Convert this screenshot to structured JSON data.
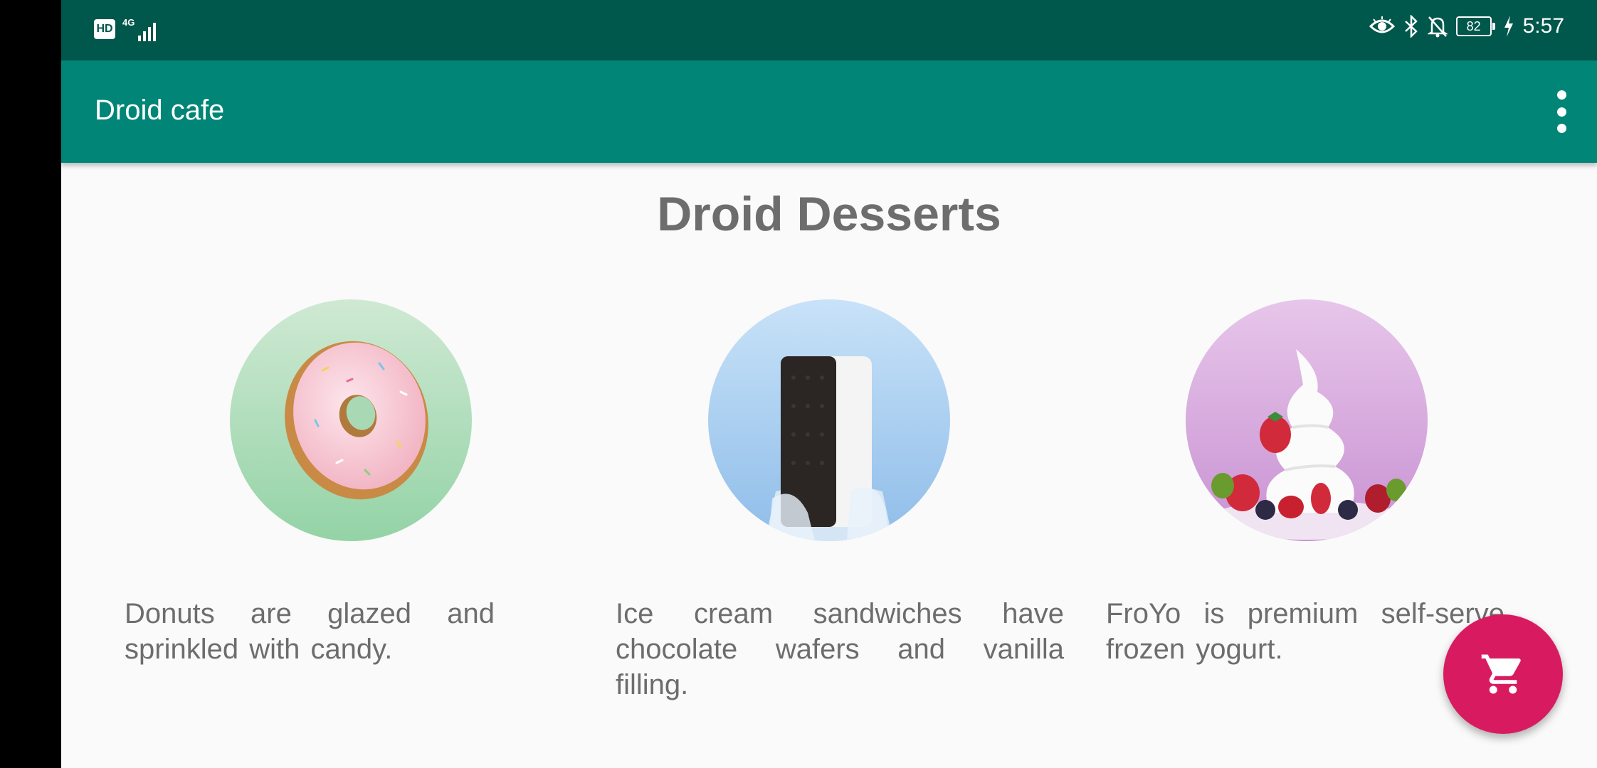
{
  "status_bar": {
    "hd_badge": "HD",
    "network": "4G",
    "battery": "82",
    "time": "5:57",
    "icons": [
      "eye-icon",
      "bluetooth-icon",
      "notifications-off-icon",
      "battery-icon",
      "charging-icon"
    ]
  },
  "app_bar": {
    "title": "Droid cafe",
    "overflow_icon": "more-vert-icon",
    "color": "#008577",
    "status_color": "#00574b"
  },
  "main": {
    "heading": "Droid Desserts",
    "items": [
      {
        "image": "donut",
        "description": "Donuts are glazed and sprinkled with candy."
      },
      {
        "image": "ice-cream-sandwich",
        "description": "Ice cream sandwiches have chocolate wafers and vanilla filling."
      },
      {
        "image": "froyo",
        "description": "FroYo is premium self-serve frozen yogurt."
      }
    ]
  },
  "fab": {
    "icon": "shopping-cart-icon",
    "color": "#d81b60"
  }
}
